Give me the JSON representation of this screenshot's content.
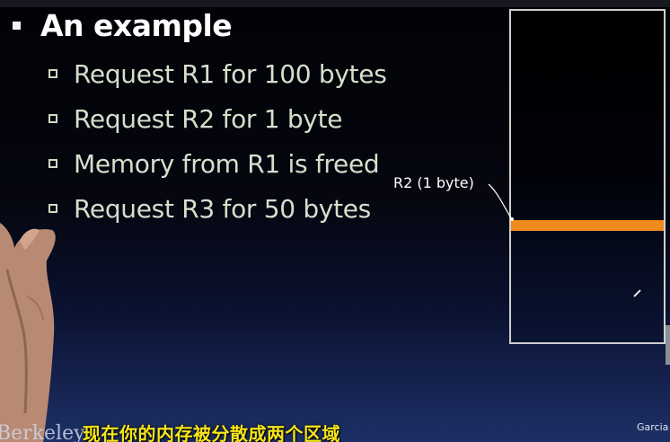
{
  "slide": {
    "title": "An example",
    "bullets": [
      "Request R1 for 100 bytes",
      "Request R2 for 1 byte",
      "Memory from R1 is freed",
      "Request R3 for 50 bytes"
    ]
  },
  "diagram": {
    "callout_label": "R2 (1 byte)"
  },
  "overlay": {
    "subtitle": "现在你的内存被分散成两个区域",
    "logo_left": "Berkeley",
    "logo_right": "Garcia"
  },
  "colors": {
    "block": "#f0891e",
    "subtitle": "#f5e51a",
    "bullet_text": "#d6dfcc"
  }
}
